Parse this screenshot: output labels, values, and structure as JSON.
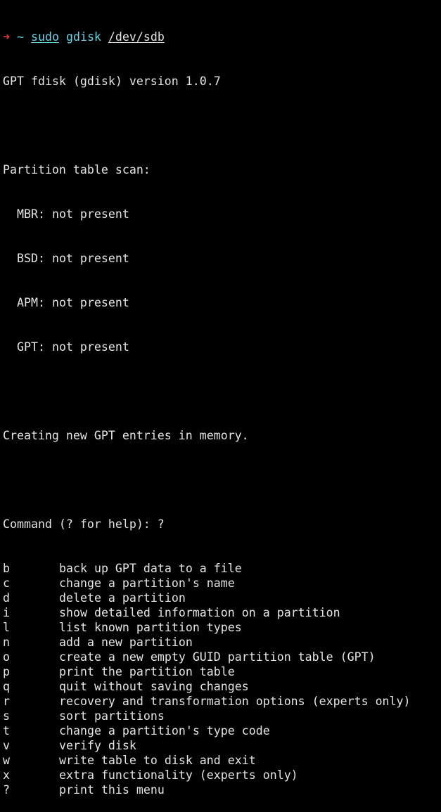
{
  "colors": {
    "background": "#000000",
    "foreground": "#e4e4e4",
    "prompt_arrow": "#e8404a",
    "command": "#6fd3e6"
  },
  "prompt": {
    "arrow": "➜",
    "dir": "~",
    "cmd_sudo": "sudo",
    "cmd_prog": "gdisk",
    "cmd_arg": "/dev/sdb"
  },
  "version_line": "GPT fdisk (gdisk) version 1.0.7",
  "scan": {
    "title": "Partition table scan:",
    "items": [
      "MBR: not present",
      "BSD: not present",
      "APM: not present",
      "GPT: not present"
    ]
  },
  "creating_line": "Creating new GPT entries in memory.",
  "command_prompt": "Command (? for help): ?",
  "menu": [
    {
      "key": "b",
      "desc": "back up GPT data to a file"
    },
    {
      "key": "c",
      "desc": "change a partition's name"
    },
    {
      "key": "d",
      "desc": "delete a partition"
    },
    {
      "key": "i",
      "desc": "show detailed information on a partition"
    },
    {
      "key": "l",
      "desc": "list known partition types"
    },
    {
      "key": "n",
      "desc": "add a new partition"
    },
    {
      "key": "o",
      "desc": "create a new empty GUID partition table (GPT)"
    },
    {
      "key": "p",
      "desc": "print the partition table"
    },
    {
      "key": "q",
      "desc": "quit without saving changes"
    },
    {
      "key": "r",
      "desc": "recovery and transformation options (experts only)"
    },
    {
      "key": "s",
      "desc": "sort partitions"
    },
    {
      "key": "t",
      "desc": "change a partition's type code"
    },
    {
      "key": "v",
      "desc": "verify disk"
    },
    {
      "key": "w",
      "desc": "write table to disk and exit"
    },
    {
      "key": "x",
      "desc": "extra functionality (experts only)"
    },
    {
      "key": "?",
      "desc": "print this menu"
    }
  ]
}
